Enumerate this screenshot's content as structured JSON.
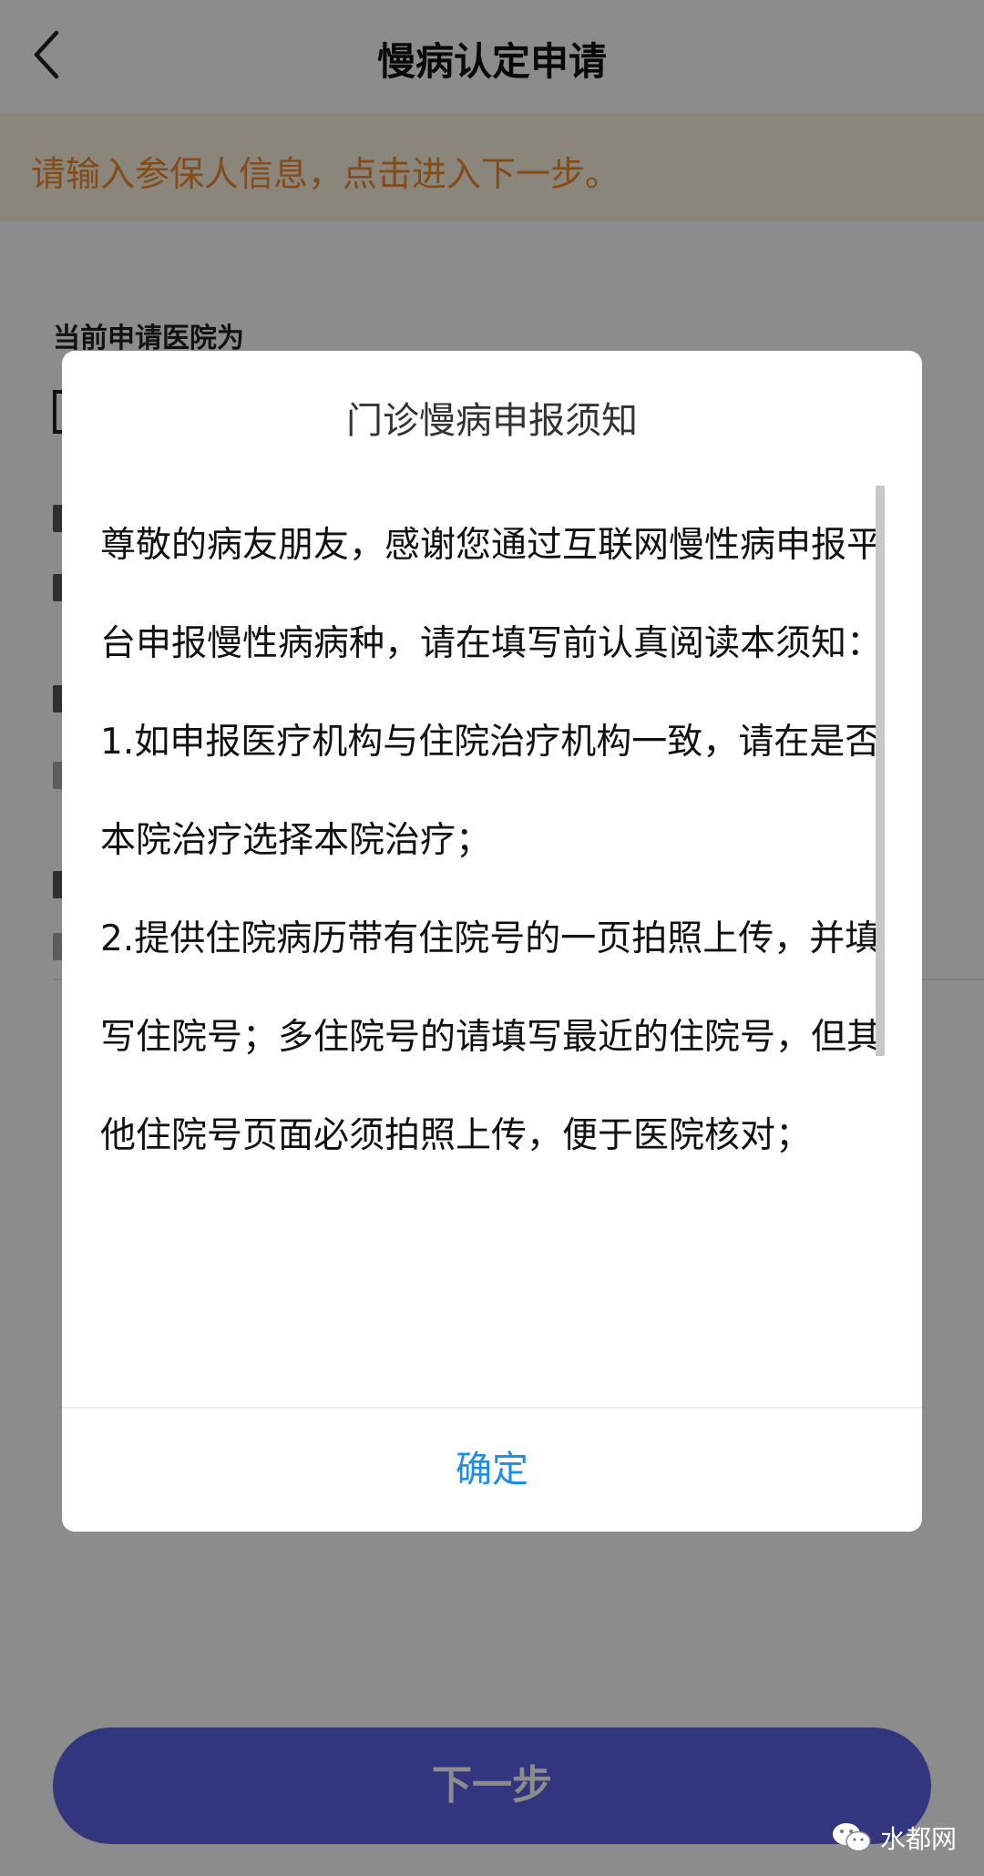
{
  "nav": {
    "title": "慢病认定申请"
  },
  "notice": {
    "text": "请输入参保人信息，点击进入下一步。"
  },
  "form": {
    "hospital_label": "当前申请医院为"
  },
  "next_button": {
    "label": "下一步"
  },
  "dialog": {
    "title": "门诊慢病申报须知",
    "paragraphs": [
      "尊敬的病友朋友，感谢您通过互联网慢性病申报平台申报慢性病病种，请在填写前认真阅读本须知：",
      "1.如申报医疗机构与住院治疗机构一致，请在是否本院治疗选择本院治疗；",
      "2.提供住院病历带有住院号的一页拍照上传，并填写住院号；多住院号的请填写最近的住院号，但其他住院号页面必须拍照上传，便于医院核对；"
    ],
    "confirm_label": "确定"
  },
  "watermark": {
    "text": "水都网"
  },
  "colors": {
    "accent_blue": "#1b8ee6",
    "button_indigo": "#5a63e6",
    "notice_orange": "#ee8a30",
    "notice_bg": "#fdf4e1"
  }
}
